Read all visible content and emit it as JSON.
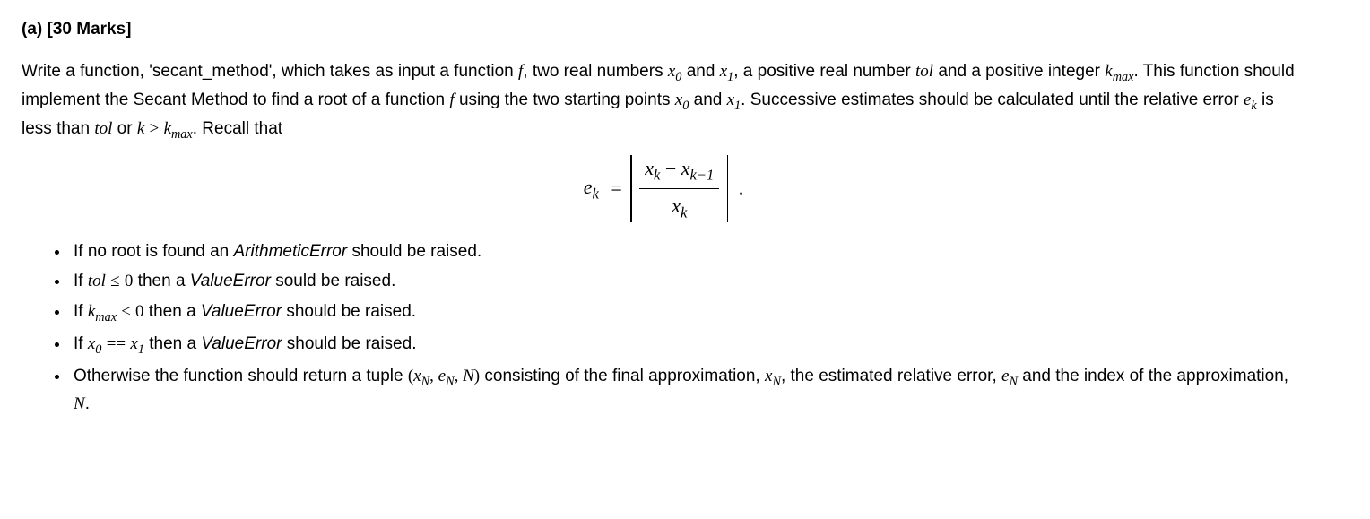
{
  "heading": "(a) [30 Marks]",
  "p1_t1": "Write a function, 'secant_method', which takes as input a function ",
  "f": "f",
  "p1_t2": ", two real numbers ",
  "x": "x",
  "s0": "0",
  "p1_t3": " and ",
  "s1": "1",
  "p1_t4": ", a positive real number ",
  "tol": "tol",
  "p1_t5": " and a positive integer ",
  "k": "k",
  "smax": "max",
  "p1_t6": ". This function should implement the Secant Method to find a root of a function ",
  "p1_t7": " using the two starting points ",
  "p1_t8": ". Successive estimates should be calculated until the relative error ",
  "e": "e",
  "sk": "k",
  "p1_t9": " is less than ",
  "p1_t10": " or ",
  "gt": ">",
  "p1_t11": ". Recall that",
  "eq_lhs_e": "e",
  "eq_lhs_k": "k",
  "eq_eq": "=",
  "eq_num_x1": "x",
  "eq_num_k": "k",
  "eq_num_minus": " − ",
  "eq_num_x2": "x",
  "eq_num_km1": "k−1",
  "eq_den_x": "x",
  "eq_den_k": "k",
  "eq_tail": ".",
  "bullets": {
    "b1_t1": "If no root is found an ",
    "b1_err": "ArithmeticError",
    "b1_t2": " should be raised.",
    "b2_t1": "If ",
    "b2_le": "≤",
    "b2_zero": "0",
    "b2_t2": " then a ",
    "b2_err": "ValueError",
    "b2_t3": " sould be raised.",
    "b3_t1": "If ",
    "b3_t2": " then a ",
    "b3_err": "ValueError",
    "b3_t3": " should be raised.",
    "b4_t1": "If ",
    "b4_eqeq": "==",
    "b4_t2": " then a ",
    "b4_err": "ValueError",
    "b4_t3": " should be raised.",
    "b5_t1": "Otherwise the function should return a tuple ",
    "b5_lp": "(",
    "b5_c1": ", ",
    "b5_c2": ", ",
    "N": "N",
    "sN": "N",
    "b5_rp": ")",
    "b5_t2": " consisting of the final approximation, ",
    "b5_t3": ", the estimated relative error, ",
    "b5_t4": " and the index of the approximation, ",
    "b5_t5": "."
  }
}
